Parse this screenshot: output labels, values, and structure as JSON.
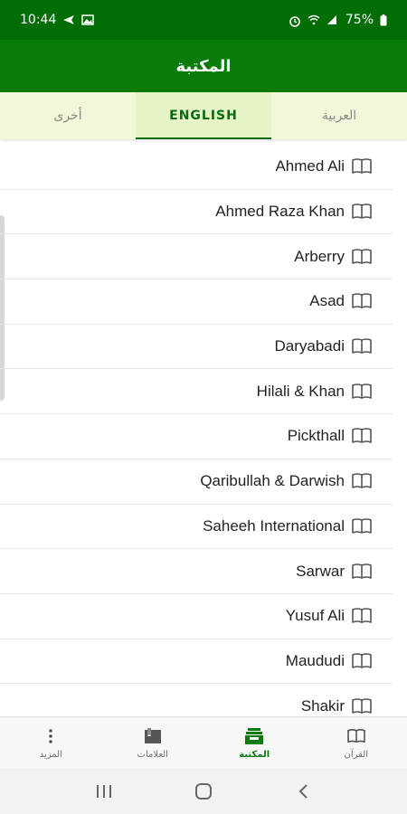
{
  "status_bar": {
    "time": "10:44",
    "battery": "75%",
    "left_icons": [
      "navigation-icon",
      "image-icon"
    ],
    "right_icons": [
      "alarm-icon",
      "wifi-icon",
      "signal-icon",
      "battery-icon"
    ]
  },
  "app_bar": {
    "title": "المكتبة"
  },
  "tabs": [
    {
      "label": "أخرى",
      "active": false
    },
    {
      "label": "ENGLISH",
      "active": true
    },
    {
      "label": "العربية",
      "active": false
    }
  ],
  "translations": [
    "Ahmed Ali",
    "Ahmed Raza Khan",
    "Arberry",
    "Asad",
    "Daryabadi",
    "Hilali & Khan",
    "Pickthall",
    "Qaribullah & Darwish",
    "Saheeh International",
    "Sarwar",
    "Yusuf Ali",
    "Maududi",
    "Shakir"
  ],
  "bottom_nav": [
    {
      "label": "المزيد",
      "icon": "more-vert-icon",
      "active": false
    },
    {
      "label": "العلامات",
      "icon": "bookmarks-icon",
      "active": false
    },
    {
      "label": "المكتبة",
      "icon": "library-icon",
      "active": true
    },
    {
      "label": "القرآن",
      "icon": "book-icon",
      "active": false
    }
  ],
  "colors": {
    "status_bar": "#006d05",
    "app_bar": "#087b0b",
    "accent": "#0a6b0f",
    "tab_bar": "#f1f8da"
  }
}
